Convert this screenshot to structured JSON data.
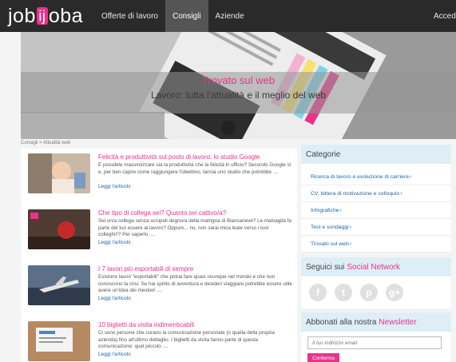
{
  "header": {
    "logo_text": {
      "left": "job",
      "mid": "ij",
      "right": "oba"
    },
    "nav": [
      {
        "label": "Offerte di lavoro"
      },
      {
        "label": "Consigli"
      },
      {
        "label": "Aziende"
      }
    ],
    "access_label": "Accedi"
  },
  "hero": {
    "title": "Trovato sul web",
    "subtitle": "Lavoro: tutta l'attualità e il meglio del web"
  },
  "breadcrumb": "Consigli  >  Attualità web",
  "articles": [
    {
      "title": "Felicità e produttività sul posto di lavoro: lo studio Google",
      "excerpt": "È possibile massimizzare sia la produttività che la felicità in ufficio? Secondo Google sì e, per ben capire come raggiungere l'obiettivo, lancia uno studio che potrebbe ....",
      "more": "Leggi l'articolo"
    },
    {
      "title": "Che tipo di collega sei? Quanto sei cattivo/a?",
      "excerpt": "Sei un/a collega senza scrupoli degno/a della matrigna di Biancaneve? Le malvagità fa parte del tuo essere al lavoro? Oppure... no, non sarai mica leale verso i tuoi colleghi!!? Per saperlo ....",
      "more": "Leggi l'articolo"
    },
    {
      "title": "I 7 lavori più esportabili di sempre",
      "excerpt": "Esistono lavori \"esportabili\" che potrai fare quasi ovunque nel mondo e che non conoscono la crisi. Se hai spirito di avventura e desideri viaggiare potrebbe essere utile avere un'idea dei mestieri ....",
      "more": "Leggi l'articolo"
    },
    {
      "title": "10 biglietti da visita indimenticabili",
      "excerpt": "Ci sono persone che curano la comunicazione personale (o quella della propria azienda) fino all'ultimo dettaglio. I biglietti da visita fanno parte di questa comunicazione: quel piccolo ....",
      "more": "Leggi l'articolo"
    }
  ],
  "sidebar": {
    "categories_title": "Categorie",
    "categories": [
      {
        "label": "Ricerca di lavoro e evoluzione di carriera"
      },
      {
        "label": "CV, lettera di motivazione e colloquio"
      },
      {
        "label": "Infografiche"
      },
      {
        "label": "Test e sondaggi"
      },
      {
        "label": "Trovato sul web"
      }
    ],
    "social_title": "Seguici sui",
    "social_highlight": "Social Network",
    "social_icons": [
      {
        "name": "facebook-icon",
        "glyph": "f"
      },
      {
        "name": "twitter-icon",
        "glyph": "t"
      },
      {
        "name": "pinterest-icon",
        "glyph": "p"
      },
      {
        "name": "google-plus-icon",
        "glyph": "g+"
      }
    ],
    "newsletter_title": "Abbonati alla nostra",
    "newsletter_highlight": "Newsletter",
    "email_placeholder": "Il tuo indirizzo email",
    "confirm_label": "Conferma"
  },
  "colors": {
    "accent": "#e8338b",
    "link": "#1f64a8",
    "topbar": "#2a2a2a",
    "panel_head": "#ddeef7"
  }
}
